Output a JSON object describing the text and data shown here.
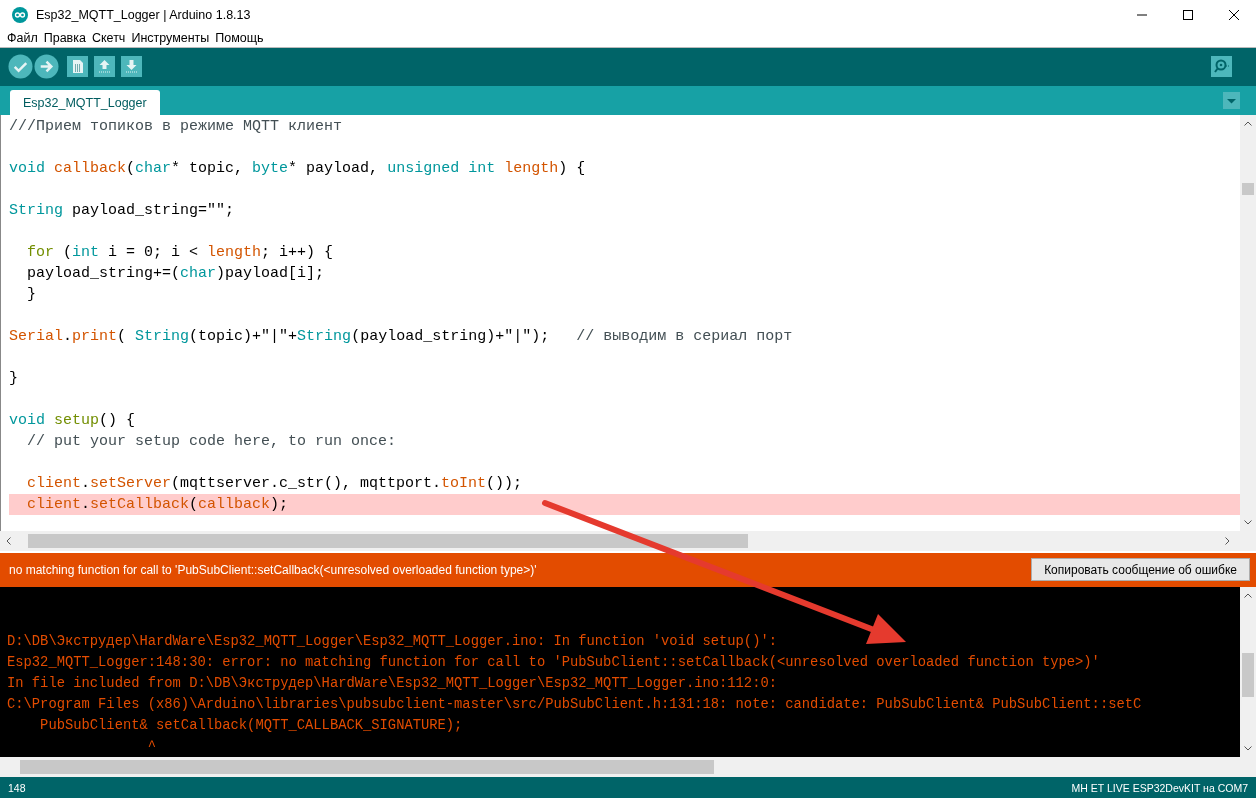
{
  "window": {
    "title": "Esp32_MQTT_Logger | Arduino 1.8.13"
  },
  "menu": [
    "Файл",
    "Правка",
    "Скетч",
    "Инструменты",
    "Помощь"
  ],
  "tabs": [
    {
      "label": "Esp32_MQTT_Logger",
      "selected": true
    }
  ],
  "editor": {
    "lines": [
      {
        "kind": "code",
        "highlighted": false,
        "tokens": [
          {
            "t": "///Прием топиков в режиме MQTT клиент",
            "kind": "comment"
          }
        ]
      },
      {
        "kind": "blank"
      },
      {
        "kind": "code",
        "highlighted": false,
        "tokens": [
          {
            "t": "void ",
            "kind": "type"
          },
          {
            "t": "callback",
            "kind": "func"
          },
          {
            "t": "(",
            "kind": "plain"
          },
          {
            "t": "char",
            "kind": "type"
          },
          {
            "t": "* topic, ",
            "kind": "plain"
          },
          {
            "t": "byte",
            "kind": "type"
          },
          {
            "t": "* payload, ",
            "kind": "plain"
          },
          {
            "t": "unsigned ",
            "kind": "type"
          },
          {
            "t": "int ",
            "kind": "type"
          },
          {
            "t": "length",
            "kind": "func"
          },
          {
            "t": ") {",
            "kind": "plain"
          }
        ]
      },
      {
        "kind": "blank"
      },
      {
        "kind": "code",
        "highlighted": false,
        "tokens": [
          {
            "t": "String",
            "kind": "type"
          },
          {
            "t": " payload_string=\"\";",
            "kind": "plain"
          }
        ]
      },
      {
        "kind": "blank"
      },
      {
        "kind": "code",
        "highlighted": false,
        "tokens": [
          {
            "t": "  for",
            "kind": "struct"
          },
          {
            "t": " (",
            "kind": "plain"
          },
          {
            "t": "int",
            "kind": "type"
          },
          {
            "t": " i = 0; i < ",
            "kind": "plain"
          },
          {
            "t": "length",
            "kind": "func"
          },
          {
            "t": "; i++) {",
            "kind": "plain"
          }
        ]
      },
      {
        "kind": "code",
        "highlighted": false,
        "tokens": [
          {
            "t": "  payload_string+=(",
            "kind": "plain"
          },
          {
            "t": "char",
            "kind": "type"
          },
          {
            "t": ")payload[i];",
            "kind": "plain"
          }
        ]
      },
      {
        "kind": "code",
        "highlighted": false,
        "tokens": [
          {
            "t": "  }",
            "kind": "plain"
          }
        ]
      },
      {
        "kind": "blank"
      },
      {
        "kind": "code",
        "highlighted": false,
        "tokens": [
          {
            "t": "Serial",
            "kind": "func"
          },
          {
            "t": ".",
            "kind": "plain"
          },
          {
            "t": "print",
            "kind": "func"
          },
          {
            "t": "( ",
            "kind": "plain"
          },
          {
            "t": "String",
            "kind": "type"
          },
          {
            "t": "(topic)+\"|\"+",
            "kind": "plain"
          },
          {
            "t": "String",
            "kind": "type"
          },
          {
            "t": "(payload_string)+\"|\");   ",
            "kind": "plain"
          },
          {
            "t": "// выводим в сериал порт",
            "kind": "comment"
          }
        ]
      },
      {
        "kind": "blank"
      },
      {
        "kind": "code",
        "highlighted": false,
        "tokens": [
          {
            "t": "}",
            "kind": "plain"
          }
        ]
      },
      {
        "kind": "blank"
      },
      {
        "kind": "code",
        "highlighted": false,
        "tokens": [
          {
            "t": "void ",
            "kind": "type"
          },
          {
            "t": "setup",
            "kind": "struct"
          },
          {
            "t": "() {",
            "kind": "plain"
          }
        ]
      },
      {
        "kind": "code",
        "highlighted": false,
        "tokens": [
          {
            "t": "  // put your setup code here, to run once:",
            "kind": "comment"
          }
        ]
      },
      {
        "kind": "blank"
      },
      {
        "kind": "code",
        "highlighted": false,
        "tokens": [
          {
            "t": "  client",
            "kind": "func"
          },
          {
            "t": ".",
            "kind": "plain"
          },
          {
            "t": "setServer",
            "kind": "func"
          },
          {
            "t": "(mqttserver.c_str(), mqttport.",
            "kind": "plain"
          },
          {
            "t": "toInt",
            "kind": "func"
          },
          {
            "t": "());",
            "kind": "plain"
          }
        ]
      },
      {
        "kind": "code",
        "highlighted": true,
        "tokens": [
          {
            "t": "  client",
            "kind": "func"
          },
          {
            "t": ".",
            "kind": "plain"
          },
          {
            "t": "setCallback",
            "kind": "func"
          },
          {
            "t": "(",
            "kind": "plain"
          },
          {
            "t": "callback",
            "kind": "func"
          },
          {
            "t": ");",
            "kind": "plain"
          }
        ]
      }
    ]
  },
  "error_bar": {
    "message": "no matching function for call to 'PubSubClient::setCallback(<unresolved overloaded function type>)'",
    "button": "Копировать сообщение об ошибке"
  },
  "console": {
    "lines": [
      "D:\\DB\\Экструдер\\HardWare\\Esp32_MQTT_Logger\\Esp32_MQTT_Logger.ino: In function 'void setup()':",
      "Esp32_MQTT_Logger:148:30: error: no matching function for call to 'PubSubClient::setCallback(<unresolved overloaded function type>)'",
      "In file included from D:\\DB\\Экструдер\\HardWare\\Esp32_MQTT_Logger\\Esp32_MQTT_Logger.ino:112:0:",
      "C:\\Program Files (x86)\\Arduino\\libraries\\pubsubclient-master\\src/PubSubClient.h:131:18: note: candidate: PubSubClient& PubSubClient::setC",
      "    PubSubClient& setCallback(MQTT_CALLBACK_SIGNATURE);",
      "                 ^"
    ]
  },
  "status_bar": {
    "line": "148",
    "board": "MH ET LIVE ESP32DevKIT на COM7"
  }
}
